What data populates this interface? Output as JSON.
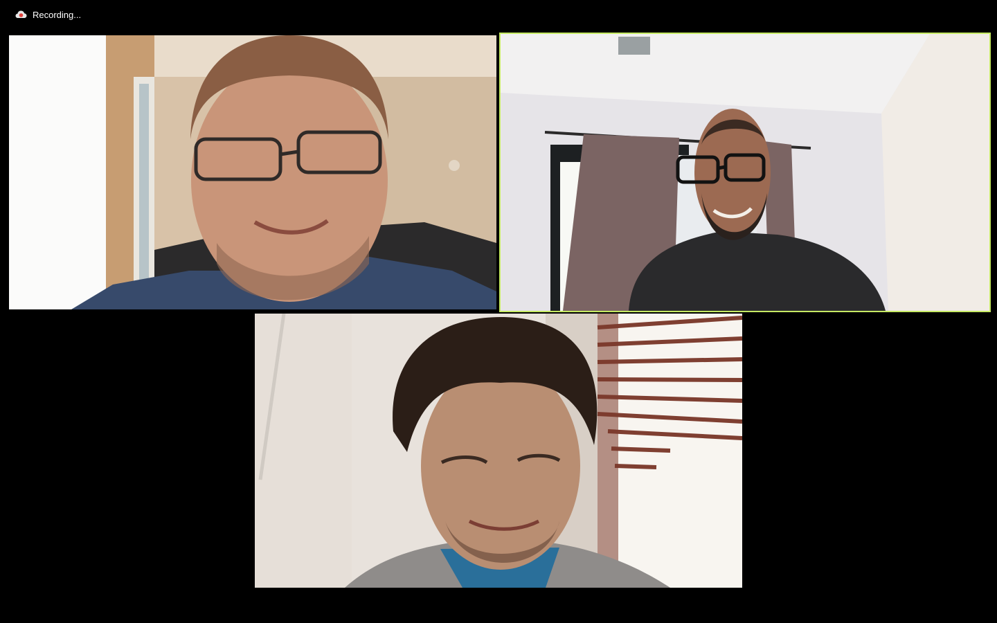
{
  "recording": {
    "label": "Recording...",
    "icon": "cloud-recording-icon",
    "icon_color": "#e0413c"
  },
  "gallery": {
    "active_speaker_border_color": "#c6ea63",
    "tiles": [
      {
        "id": "participant-1",
        "active": false
      },
      {
        "id": "participant-2",
        "active": true
      },
      {
        "id": "participant-3",
        "active": false
      }
    ]
  }
}
